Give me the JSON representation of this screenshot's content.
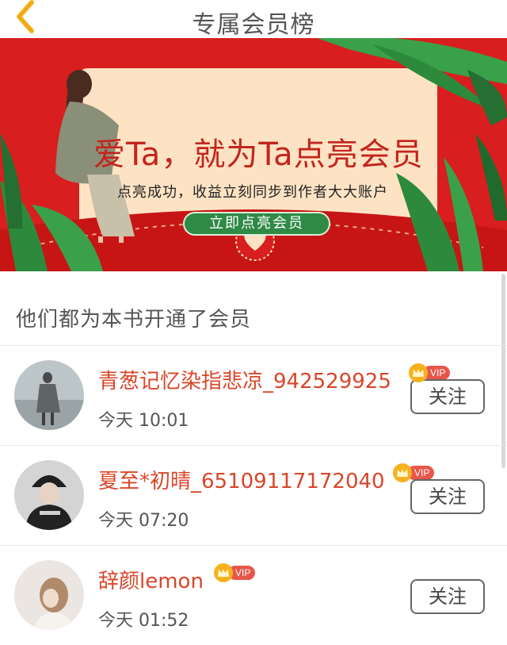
{
  "header": {
    "title": "专属会员榜",
    "back_icon": "chevron-left-icon",
    "back_color": "#f5b21e"
  },
  "banner": {
    "headline": "爱Ta，就为Ta点亮会员",
    "subtext": "点亮成功，收益立刻同步到作者大大账户",
    "cta": "立即点亮会员",
    "bg_color": "#d81e1e",
    "card_color": "#fde3c4",
    "cta_color": "#2f8a45"
  },
  "section": {
    "title": "他们都为本书开通了会员"
  },
  "members": [
    {
      "name": "青葱记忆染指悲凉_942529925",
      "vip": "VIP",
      "time": "今天 10:01",
      "follow": "关注"
    },
    {
      "name": "夏至*初晴_65109117172040",
      "vip": "VIP",
      "time": "今天 07:20",
      "follow": "关注"
    },
    {
      "name": "辞颜lemon",
      "vip": "VIP",
      "time": "今天 01:52",
      "follow": "关注"
    }
  ]
}
